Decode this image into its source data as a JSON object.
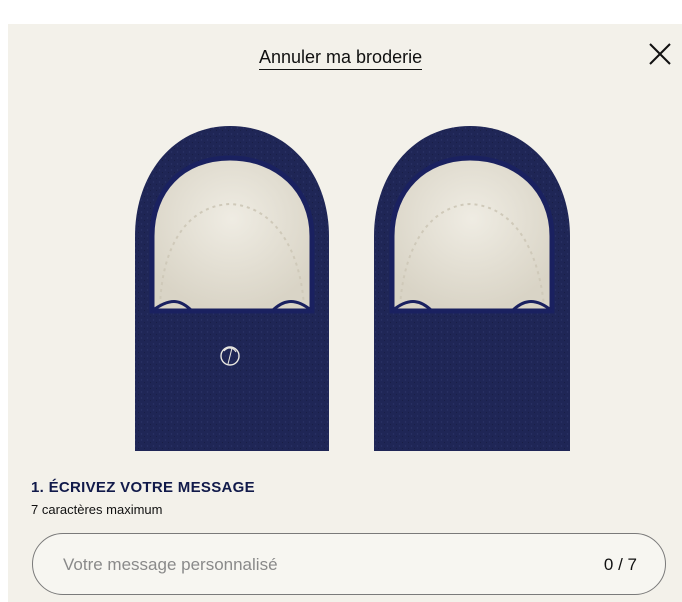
{
  "modal": {
    "cancel_label": "Annuler ma broderie",
    "close_icon": "close-icon"
  },
  "product_image": {
    "subject": "navy felt slippers with white shearling lining",
    "colors": {
      "felt": "#1f2656",
      "trim": "#1a2160",
      "lining": "#e9e5da",
      "background": "#f3f1ea"
    }
  },
  "step": {
    "title": "1. ÉCRIVEZ VOTRE MESSAGE",
    "hint": "7 caractères maximum"
  },
  "message_input": {
    "value": "",
    "placeholder": "Votre message personnalisé",
    "counter": "0 / 7"
  }
}
